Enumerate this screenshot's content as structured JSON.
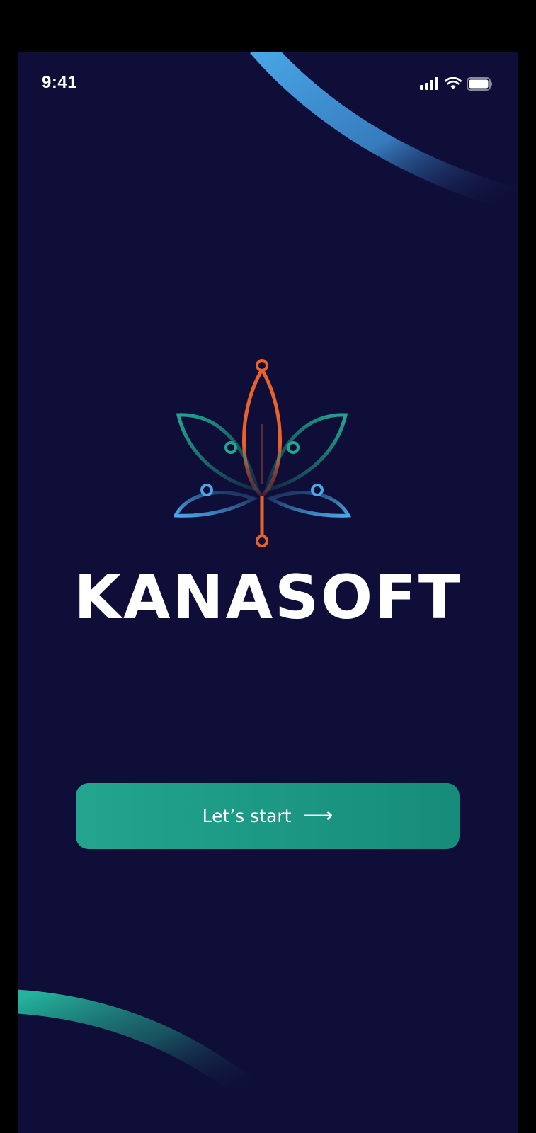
{
  "status_bar": {
    "time": "9:41",
    "icons": [
      "signal-icon",
      "wifi-icon",
      "battery-icon"
    ]
  },
  "brand": {
    "name": "KANASOFT",
    "logo_icon": "cannabis-leaf-circuit-logo"
  },
  "cta": {
    "label": "Let’s start",
    "arrow": "⟶"
  },
  "colors": {
    "background": "#0f0e38",
    "accent_teal": "#1f9e8b",
    "accent_blue": "#4aa8e6",
    "accent_orange": "#e8622b",
    "text": "#ffffff"
  }
}
